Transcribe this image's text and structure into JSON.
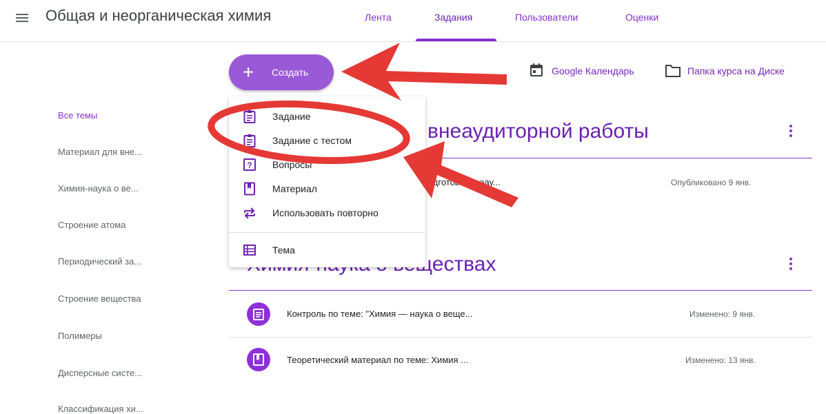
{
  "header": {
    "course_title": "Общая и неорганическая химия",
    "tabs": [
      "Лента",
      "Задания",
      "Пользователи",
      "Оценки"
    ],
    "active_tab": "Задания"
  },
  "toolbar": {
    "create_label": "Создать",
    "calendar_label": "Google Календарь",
    "folder_label": "Папка курса на Диске"
  },
  "sidebar": {
    "items": [
      "Все темы",
      "Материал для вне...",
      "Химия-наука о ве...",
      "Строение атома",
      "Периодический за...",
      "Строение вещества",
      "Полимеры",
      "Дисперсные систе...",
      "Классификация хи..."
    ]
  },
  "create_menu": {
    "items": [
      {
        "label": "Задание",
        "icon": "assignment-icon"
      },
      {
        "label": "Задание с тестом",
        "icon": "quiz-assignment-icon"
      },
      {
        "label": "Вопросы",
        "icon": "question-icon"
      },
      {
        "label": "Материал",
        "icon": "material-icon"
      },
      {
        "label": "Использовать повторно",
        "icon": "reuse-icon"
      },
      {
        "label": "Тема",
        "icon": "topic-icon"
      }
    ]
  },
  "sections": [
    {
      "title": "внеаудиторной работы",
      "rows": [
        {
          "title": "...одготов... внеау...",
          "status": "Опубликовано 9 янв."
        }
      ]
    },
    {
      "title": "Химия-наука о веществах",
      "rows": [
        {
          "title": "Контроль по теме: \"Химия — наука о веще...",
          "status": "Изменено: 9 янв.",
          "icon": "assignment-icon"
        },
        {
          "title": "Теоретический материал по теме: Химия ...",
          "status": "Изменено: 13 янв.",
          "icon": "material-icon"
        }
      ]
    }
  ],
  "colors": {
    "accent": "#8430ce",
    "create_button": "#9a59d6",
    "annotation": "#e53935"
  }
}
